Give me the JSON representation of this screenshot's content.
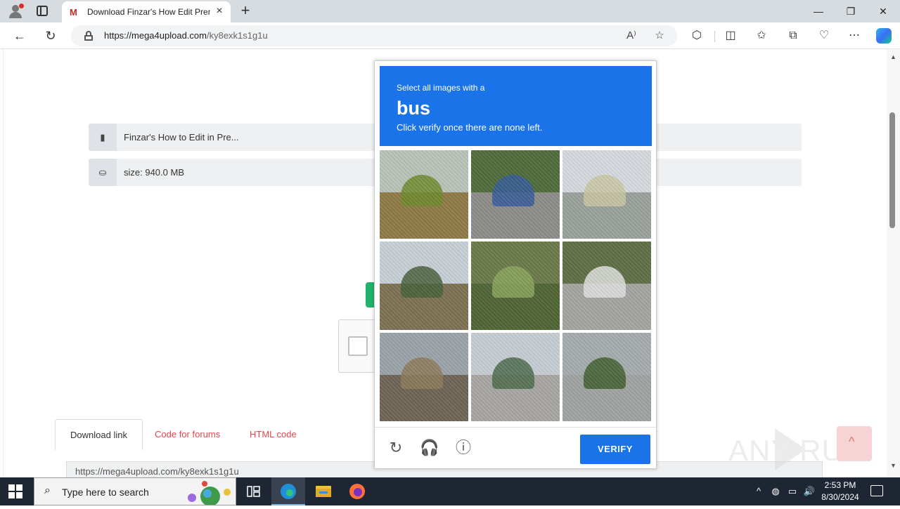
{
  "browser": {
    "tab_title": "Download Finzar's How Edit Prem",
    "tab_favicon": "M",
    "url_host": "https://mega4upload.com",
    "url_path": "/ky8exk1s1g1u"
  },
  "page": {
    "file_name": "Finzar's How to Edit in Pre...",
    "file_size": "size: 940.0 MB",
    "tabs": [
      "Download link",
      "Code for forums",
      "HTML code"
    ],
    "link_text": "https://mega4upload.com/ky8exk1s1g1u",
    "watermark": "ANY RUN"
  },
  "captcha": {
    "instruction": "Select all images with a",
    "target": "bus",
    "hint": "Click verify once there are none left.",
    "verify_label": "VERIFY",
    "tiles": [
      {
        "sky": "#b9c4b8",
        "ground": "#8f7a45",
        "accent": "#6e8a2c"
      },
      {
        "sky": "#4f6b3b",
        "ground": "#8c8c88",
        "accent": "#355a9a"
      },
      {
        "sky": "#d6dadf",
        "ground": "#9aa19a",
        "accent": "#c9c7a4"
      },
      {
        "sky": "#c8cfd6",
        "ground": "#7c7152",
        "accent": "#46603a"
      },
      {
        "sky": "#6a7a4a",
        "ground": "#4e6434",
        "accent": "#8aa45a"
      },
      {
        "sky": "#5f6e44",
        "ground": "#a4a4a0",
        "accent": "#e2e2e2"
      },
      {
        "sky": "#9aa3a8",
        "ground": "#6f6455",
        "accent": "#8d7a5a"
      },
      {
        "sky": "#c6cdd3",
        "ground": "#a8a6a2",
        "accent": "#4a6a4a"
      },
      {
        "sky": "#a6acae",
        "ground": "#9fa3a2",
        "accent": "#3f5e2e"
      }
    ]
  },
  "taskbar": {
    "search_placeholder": "Type here to search",
    "time": "2:53 PM",
    "date": "8/30/2024"
  }
}
